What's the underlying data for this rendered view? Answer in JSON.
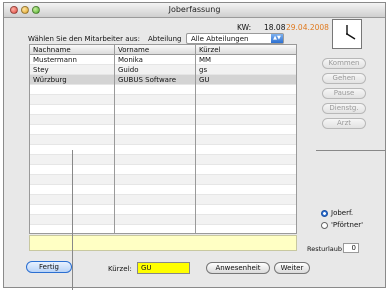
{
  "window": {
    "title": "Joberfassung"
  },
  "header": {
    "kw_label": "KW:",
    "kw_value": "18.08",
    "date": "29.04.2008",
    "date_color": "#e07a1f"
  },
  "filter": {
    "prompt": "Wählen Sie den Mitarbeiter aus:",
    "abteilung_label": "Abteilung",
    "abteilung_value": "Alle Abteilungen"
  },
  "table": {
    "columns": [
      "Nachname",
      "Vorname",
      "Kürzel"
    ],
    "rows": [
      [
        "Mustermann",
        "Monika",
        "MM"
      ],
      [
        "Stey",
        "Guido",
        "gs"
      ],
      [
        "Würzburg",
        "GUBUS Software",
        "GU"
      ]
    ],
    "selected_row": 2
  },
  "side_buttons": {
    "kommen": "Kommen",
    "gehen": "Gehen",
    "pause": "Pause",
    "dienstg": "Dienstg.",
    "arzt": "Arzt"
  },
  "mode": {
    "options": [
      "Joberf.",
      "'Pförtner'"
    ],
    "selected": 0
  },
  "rest": {
    "label": "Resturlaub",
    "value": "0"
  },
  "footer": {
    "fertig": "Fertig",
    "kuerzel_label": "Kürzel:",
    "kuerzel_value": "GU",
    "anwesenheit": "Anwesenheit",
    "weiter": "Weiter"
  }
}
